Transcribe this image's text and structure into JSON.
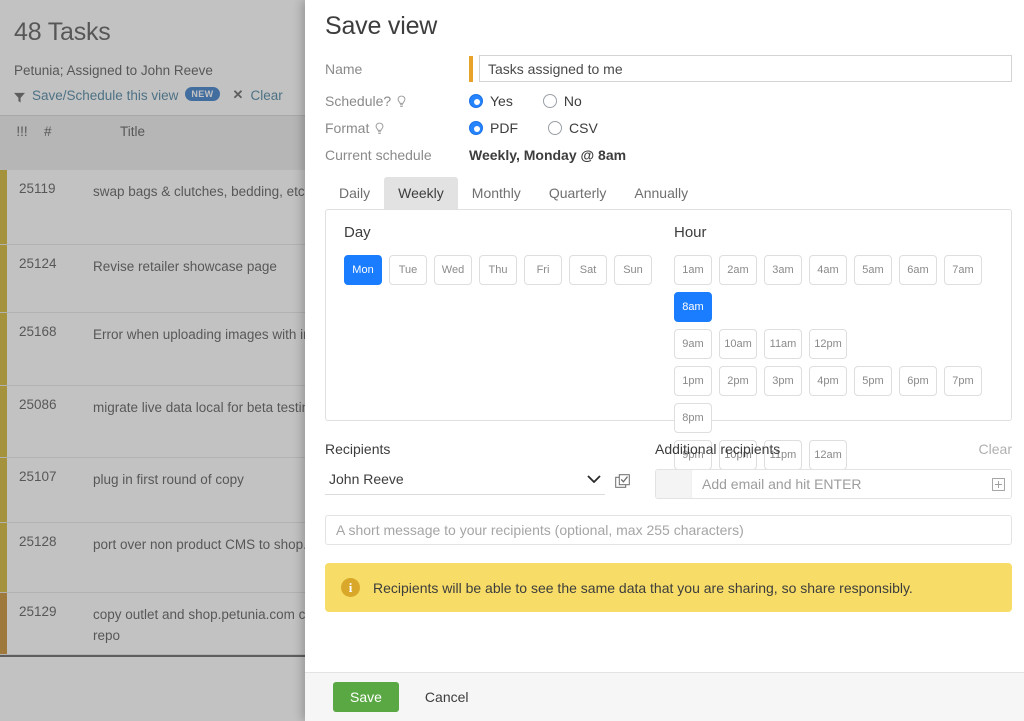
{
  "background": {
    "title": "48 Tasks",
    "subtitle": "Petunia; Assigned to John Reeve",
    "save_schedule_link": "Save/Schedule this view",
    "new_badge": "NEW",
    "clear_link": "Clear",
    "columns": [
      "!!!",
      "#",
      "Title"
    ],
    "rows": [
      {
        "id": "25119",
        "title": "swap bags & clutches, bedding, etc with collections",
        "stripe": "#c8a80c"
      },
      {
        "id": "25124",
        "title": "Revise retailer showcase page",
        "stripe": "#c8a80c"
      },
      {
        "id": "25168",
        "title": "Error when uploading images with inline admin",
        "stripe": "#c8a80c"
      },
      {
        "id": "25086",
        "title": "migrate live data local for beta testing",
        "stripe": "#c8a80c"
      },
      {
        "id": "25107",
        "title": "plug in first round of copy",
        "stripe": "#c8a80c"
      },
      {
        "id": "25128",
        "title": "port over non product CMS to shop.petunia.com code",
        "stripe": "#c8a80c"
      },
      {
        "id": "25129",
        "title": "copy outlet and shop.petunia.com code base and make new repo",
        "stripe": "#c07a0a"
      }
    ]
  },
  "dialog": {
    "title": "Save view",
    "name": {
      "label": "Name",
      "value": "Tasks assigned to me",
      "placeholder": ""
    },
    "schedule": {
      "label": "Schedule?",
      "options": [
        "Yes",
        "No"
      ],
      "selected": "Yes"
    },
    "format": {
      "label": "Format",
      "options": [
        "PDF",
        "CSV"
      ],
      "selected": "PDF"
    },
    "current_schedule": {
      "label": "Current schedule",
      "value": "Weekly, Monday @ 8am"
    },
    "tabs": [
      {
        "label": "Daily",
        "active": false
      },
      {
        "label": "Weekly",
        "active": true
      },
      {
        "label": "Monthly",
        "active": false
      },
      {
        "label": "Quarterly",
        "active": false
      },
      {
        "label": "Annually",
        "active": false
      }
    ],
    "day_section": {
      "heading": "Day",
      "options": [
        "Mon",
        "Tue",
        "Wed",
        "Thu",
        "Fri",
        "Sat",
        "Sun"
      ],
      "selected": "Mon"
    },
    "hour_section": {
      "heading": "Hour",
      "rows": [
        [
          "1am",
          "2am",
          "3am",
          "4am",
          "5am",
          "6am",
          "7am",
          "8am"
        ],
        [
          "9am",
          "10am",
          "11am",
          "12pm"
        ],
        [
          "1pm",
          "2pm",
          "3pm",
          "4pm",
          "5pm",
          "6pm",
          "7pm",
          "8pm"
        ],
        [
          "9pm",
          "10pm",
          "11pm",
          "12am"
        ]
      ],
      "selected": "8am"
    },
    "recipients": {
      "label": "Recipients",
      "selected": "John Reeve"
    },
    "additional_recipients": {
      "label": "Additional recipients",
      "clear_label": "Clear",
      "placeholder": "Add email and hit ENTER"
    },
    "message": {
      "placeholder": "A short message to your recipients (optional, max 255 characters)"
    },
    "warning": {
      "text": "Recipients will be able to see the same data that you are sharing, so share responsibly."
    },
    "footer": {
      "save_label": "Save",
      "cancel_label": "Cancel"
    }
  },
  "colors": {
    "accent_blue": "#1a7cff",
    "radio_blue": "#2684ff",
    "save_green": "#5aa844",
    "warning_yellow": "#f7dd67",
    "name_marker": "#e8a32a",
    "link_blue": "#2b6c8f"
  }
}
